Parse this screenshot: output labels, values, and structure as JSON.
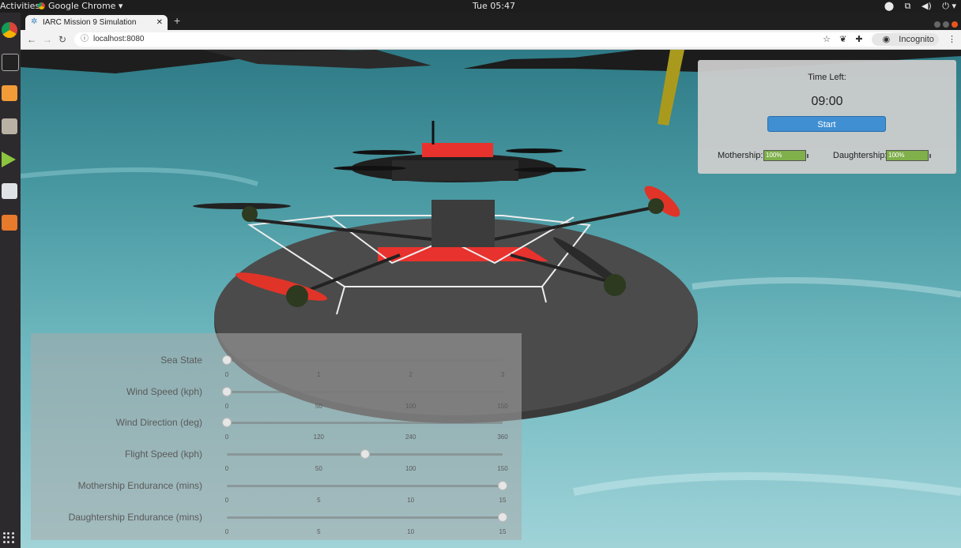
{
  "system": {
    "activities": "Activities",
    "app_name": "Google Chrome ▾",
    "clock": "Tue 05:47"
  },
  "browser": {
    "tab_title": "IARC Mission 9 Simulation",
    "url": "localhost:8080",
    "incognito": "Incognito"
  },
  "hud": {
    "time_left_label": "Time Left:",
    "time_left": "09:00",
    "start_button": "Start",
    "mothership_label": "Mothership:",
    "mothership_battery": "100%",
    "mothership_level": 1.0,
    "daughtership_label": "Daughtership:",
    "daughtership_battery": "100%",
    "daughtership_level": 1.0
  },
  "sliders": [
    {
      "name": "Sea State",
      "min": 0,
      "max": 3,
      "value": 0,
      "ticks": [
        "0",
        "1",
        "2",
        "3"
      ]
    },
    {
      "name": "Wind Speed (kph)",
      "min": 0,
      "max": 150,
      "value": 0,
      "ticks": [
        "0",
        "50",
        "100",
        "150"
      ]
    },
    {
      "name": "Wind Direction (deg)",
      "min": 0,
      "max": 360,
      "value": 0,
      "ticks": [
        "0",
        "120",
        "240",
        "360"
      ]
    },
    {
      "name": "Flight Speed (kph)",
      "min": 0,
      "max": 150,
      "value": 75,
      "ticks": [
        "0",
        "50",
        "100",
        "150"
      ]
    },
    {
      "name": "Mothership Endurance (mins)",
      "min": 0,
      "max": 15,
      "value": 15,
      "ticks": [
        "0",
        "5",
        "10",
        "15"
      ]
    },
    {
      "name": "Daughtership Endurance (mins)",
      "min": 0,
      "max": 15,
      "value": 15,
      "ticks": [
        "0",
        "5",
        "10",
        "15"
      ]
    }
  ]
}
